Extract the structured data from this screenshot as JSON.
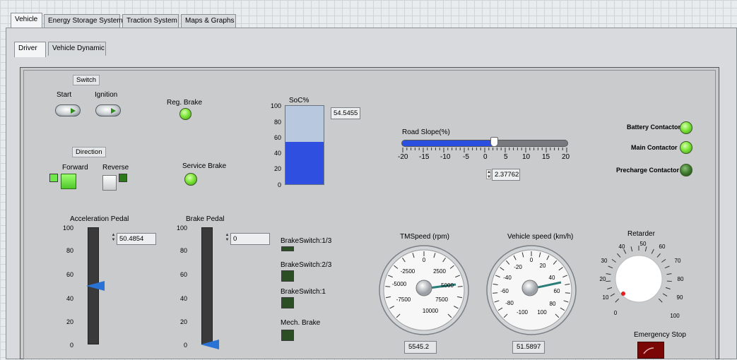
{
  "top_tabs": [
    "Vehicle",
    "Energy Storage System",
    "Traction System",
    "Maps & Graphs"
  ],
  "sub_tabs": [
    "Driver",
    "Vehicle Dynamic"
  ],
  "switch_panel": {
    "title": "Switch",
    "start_label": "Start",
    "ignition_label": "Ignition"
  },
  "direction_panel": {
    "title": "Direction",
    "forward_label": "Forward",
    "reverse_label": "Reverse"
  },
  "reg_brake": {
    "label": "Reg. Brake",
    "state": "on"
  },
  "service_brake": {
    "label": "Service Brake",
    "state": "on"
  },
  "soc": {
    "label": "SoC%",
    "value": "54.5455",
    "fill": 0.545,
    "ticks": [
      "100",
      "80",
      "60",
      "40",
      "20",
      "0"
    ]
  },
  "road_slope": {
    "label": "Road Slope(%)",
    "value": "2.37762",
    "ticks": [
      "-20",
      "-15",
      "-10",
      "-5",
      "0",
      "5",
      "10",
      "15",
      "20"
    ]
  },
  "contactors": [
    {
      "label": "Battery Contactor",
      "state": "on"
    },
    {
      "label": "Main Contactor",
      "state": "on"
    },
    {
      "label": "Precharge Contactor",
      "state": "off"
    }
  ],
  "acceleration_pedal": {
    "label": "Acceleration Pedal",
    "value": "50.4854",
    "ticks": [
      "100",
      "80",
      "60",
      "40",
      "20",
      "0"
    ]
  },
  "brake_pedal": {
    "label": "Brake Pedal",
    "value": "0",
    "ticks": [
      "100",
      "80",
      "60",
      "40",
      "20",
      "0"
    ]
  },
  "brake_switches": [
    "BrakeSwitch:1/3",
    "BrakeSwitch:2/3",
    "BrakeSwitch:1",
    "Mech. Brake"
  ],
  "tm_speed": {
    "label": "TMSpeed (rpm)",
    "value": "5545.2",
    "ticks": [
      "0",
      "2500",
      "5000",
      "7500",
      "10000",
      "-7500",
      "-5000",
      "-2500"
    ]
  },
  "vehicle_speed": {
    "label": "Vehicle speed (km/h)",
    "value": "51.5897",
    "ticks": [
      "0",
      "20",
      "40",
      "60",
      "80",
      "100",
      "-100",
      "-80",
      "-60",
      "-40",
      "-20"
    ]
  },
  "retarder": {
    "label": "Retarder",
    "ticks": [
      "0",
      "10",
      "20",
      "30",
      "40",
      "50",
      "60",
      "70",
      "80",
      "90",
      "100"
    ]
  },
  "emergency_stop": {
    "label": "Emergency Stop"
  }
}
